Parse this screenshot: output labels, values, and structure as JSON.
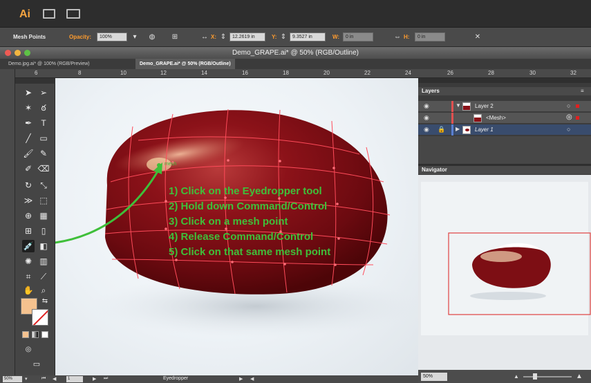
{
  "app": {
    "logo": "Ai",
    "window_title": "Demo_GRAPE.ai* @ 50% (RGB/Outline)"
  },
  "control_bar": {
    "mode_label": "Mesh Points",
    "opacity_label": "Opacity:",
    "opacity_value": "100%",
    "x_label": "X:",
    "x_value": "12.2619 in",
    "y_label": "Y:",
    "y_value": "9.3527 in",
    "w_label": "W:",
    "h_label": "H:",
    "w_value": "0 in",
    "h_value": "0 in"
  },
  "tabs": [
    {
      "label": "Demo.jpg.ai* @ 100% (RGB/Preview)"
    },
    {
      "label": "Demo_GRAPE.ai* @ 50% (RGB/Outline)"
    }
  ],
  "ruler": {
    "ticks": [
      "6",
      "8",
      "10",
      "12",
      "14",
      "16",
      "18",
      "20",
      "22",
      "24",
      "26",
      "28",
      "30",
      "32"
    ]
  },
  "toolbar": {
    "tools": [
      "selection-tool",
      "direct-selection-tool",
      "magic-wand-tool",
      "lasso-tool",
      "pen-tool",
      "type-tool",
      "line-tool",
      "rectangle-tool",
      "paintbrush-tool",
      "pencil-tool",
      "blob-brush-tool",
      "eraser-tool",
      "rotate-tool",
      "scale-tool",
      "width-tool",
      "free-transform-tool",
      "shape-builder-tool",
      "perspective-grid-tool",
      "mesh-tool",
      "gradient-tool",
      "eyedropper-tool",
      "blend-tool",
      "symbol-sprayer-tool",
      "column-graph-tool",
      "artboard-tool",
      "slice-tool",
      "hand-tool",
      "zoom-tool"
    ]
  },
  "overlay": {
    "mesh_label": "mesh",
    "steps": [
      "1) Click on the Eyedropper tool",
      "2) Hold down Command/Control",
      "3) Click on a mesh point",
      "4) Release Command/Control",
      "5) Click on that same mesh point"
    ]
  },
  "layers_panel": {
    "title": "Layers",
    "rows": [
      {
        "name": "Layer 2"
      },
      {
        "name": "<Mesh>"
      },
      {
        "name": "Layer 1"
      }
    ]
  },
  "navigator_panel": {
    "title": "Navigator",
    "zoom": "50%"
  },
  "status_bar": {
    "zoom": "50%",
    "page": "1",
    "tool": "Eyedropper"
  },
  "colors": {
    "accent": "#f7a541",
    "fill_swatch": "#f5c28f",
    "grape_red": "#8b1117",
    "mesh_line": "#ff4b5a",
    "annotation_green": "#3fbf3a",
    "panel_dark": "#3b3b3b"
  },
  "icons": {
    "eyedropper": "eyedropper-icon",
    "search": "search-icon",
    "panel_expand": "panel-menu-icon"
  }
}
